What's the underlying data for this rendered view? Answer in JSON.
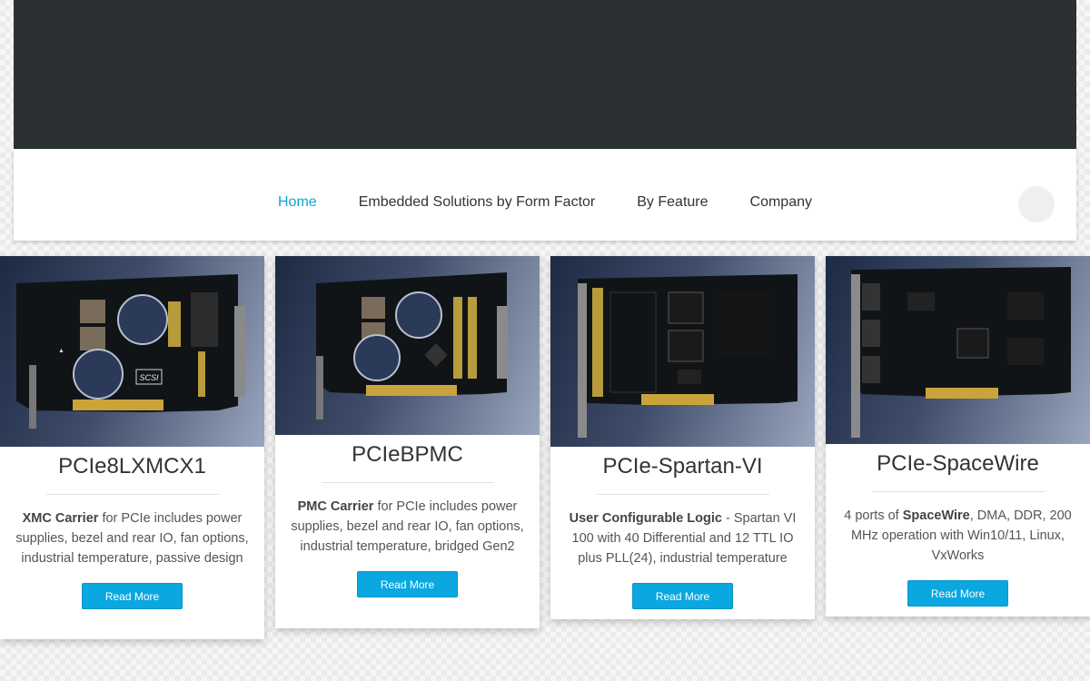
{
  "nav": {
    "items": [
      {
        "label": "Home",
        "active": true
      },
      {
        "label": "Embedded Solutions by Form Factor",
        "active": false
      },
      {
        "label": "By Feature",
        "active": false
      },
      {
        "label": "Company",
        "active": false
      }
    ],
    "search_icon": "search-icon"
  },
  "cards": [
    {
      "title": "PCIe8LXMCX1",
      "desc_bold": "XMC Carrier",
      "desc_rest": " for PCIe includes power supplies, bezel and rear IO, fan options, industrial temperature, passive design",
      "button": "Read More",
      "board_label": "SCSI"
    },
    {
      "title": "PCIeBPMC",
      "desc_bold": "PMC Carrier",
      "desc_rest": " for PCIe includes power supplies, bezel and rear IO, fan options, industrial temperature, bridged Gen2",
      "button": "Read More"
    },
    {
      "title": "PCIe-Spartan-VI",
      "desc_bold": "User Configurable Logic",
      "desc_rest": " - Spartan VI 100 with 40 Differential and 12 TTL IO plus PLL(24), industrial temperature",
      "button": "Read More"
    },
    {
      "title": "PCIe-SpaceWire",
      "desc_pre": "4 ports of ",
      "desc_bold": "SpaceWire",
      "desc_rest": ", DMA, DDR, 200 MHz operation with Win10/11, Linux, VxWorks",
      "button": "Read More"
    }
  ],
  "colors": {
    "header_dark": "#2b3133",
    "nav_active": "#15a3cf",
    "button": "#0aa7e0"
  }
}
